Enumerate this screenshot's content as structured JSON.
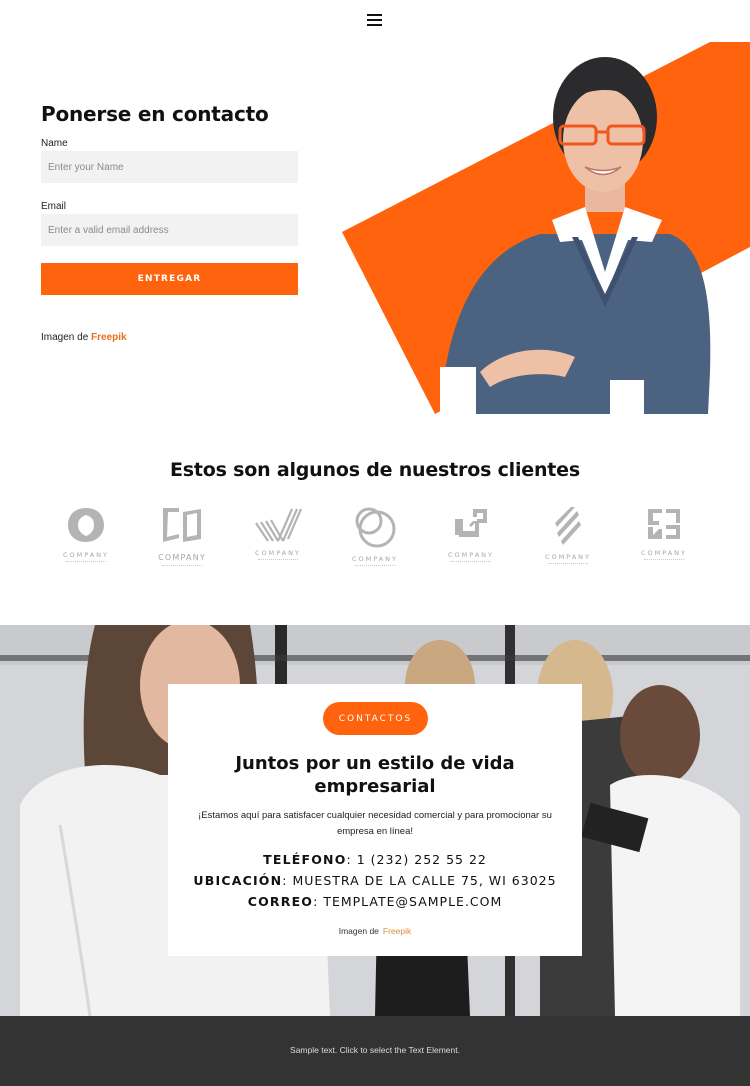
{
  "header": {
    "menu_icon": "hamburger-menu-icon"
  },
  "contact_form": {
    "title": "Ponerse en contacto",
    "name_label": "Name",
    "name_placeholder": "Enter your Name",
    "name_value": "",
    "email_label": "Email",
    "email_placeholder": "Enter a valid email address",
    "email_value": "",
    "submit_label": "ENTREGAR",
    "credit_prefix": "Imagen de",
    "credit_link": "Freepik"
  },
  "clients": {
    "title": "Estos son algunos de nuestros clientes",
    "logos": [
      {
        "text": "COMPANY",
        "icon": "ring-logo-icon"
      },
      {
        "text": "COMPANY",
        "icon": "open-book-logo-icon"
      },
      {
        "text": "COMPANY",
        "icon": "striped-check-logo-icon"
      },
      {
        "text": "COMPANY",
        "icon": "overlapping-circles-logo-icon"
      },
      {
        "text": "COMPANY",
        "icon": "squares-arrow-logo-icon"
      },
      {
        "text": "COMPANY",
        "icon": "diagonal-slashes-logo-icon"
      },
      {
        "text": "COMPANY",
        "icon": "geometric-square-logo-icon"
      }
    ]
  },
  "contact_banner": {
    "pill_label": "CONTACTOS",
    "title": "Juntos por un estilo de vida empresarial",
    "text": "¡Estamos aquí para satisfacer cualquier necesidad comercial y para promocionar su empresa en línea!",
    "phone_label": "TELÉFONO",
    "phone_value": ": 1 (232) 252 55 22",
    "location_label": "UBICACIÓN",
    "location_value": ": MUESTRA DE LA CALLE 75, WI 63025",
    "email_label": "CORREO",
    "email_value": ": TEMPLATE@SAMPLE.COM",
    "credit_prefix": "Imagen de",
    "credit_link": "Freepik"
  },
  "footer": {
    "text": "Sample text. Click to select the Text Element."
  },
  "colors": {
    "accent": "#ff630e",
    "footer_bg": "#333333",
    "input_bg": "#f2f2f2",
    "link": "#e7701e"
  }
}
